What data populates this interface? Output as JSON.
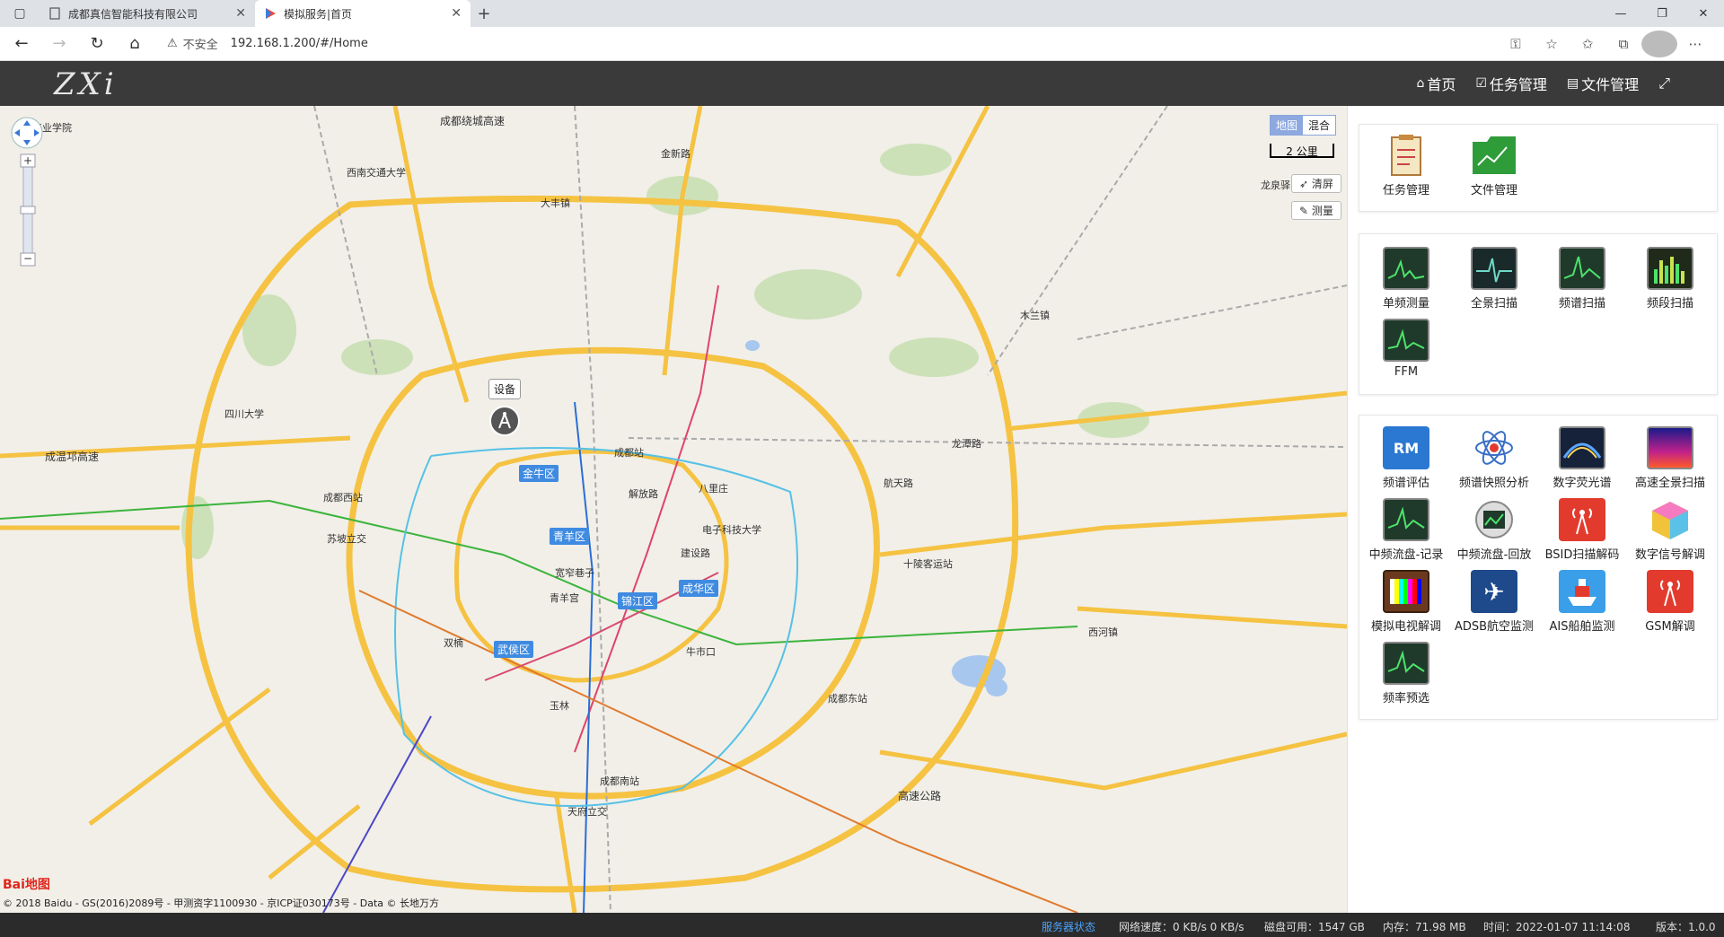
{
  "browser": {
    "tabs": [
      {
        "label": "成都真信智能科技有限公司",
        "active": false
      },
      {
        "label": "模拟服务|首页",
        "active": true
      }
    ],
    "insecure_label": "不安全",
    "url": "192.168.1.200/#/Home"
  },
  "header": {
    "logo": "ZXi",
    "nav": [
      {
        "label": "首页",
        "icon": "home-icon"
      },
      {
        "label": "任务管理",
        "icon": "checkbox-icon"
      },
      {
        "label": "文件管理",
        "icon": "file-icon"
      }
    ]
  },
  "map": {
    "type_options": [
      "地图",
      "混合"
    ],
    "scale": "2 公里",
    "clear_label": "清屏",
    "measure_label": "测量",
    "device_label": "设备",
    "baidu_label": "Bai地图",
    "copyright": "© 2018 Baidu - GS(2016)2089号 - 甲测资字1100930 - 京ICP证030173号 - Data © 长地万方",
    "districts": [
      "金牛区",
      "青羊区",
      "锦江区",
      "成华区",
      "武侯区"
    ],
    "labels": [
      "成都绕城高速",
      "西南交通大学",
      "四川大学",
      "成都站",
      "八里庄",
      "解放路",
      "建设路",
      "成都东站",
      "成都南站",
      "航天路",
      "龙泉驿",
      "双楠",
      "苏坡立交",
      "成温邛高速",
      "龙潭路",
      "西河镇",
      "木兰镇",
      "金新路",
      "大丰镇",
      "天府立交",
      "成都工业学院",
      "牛市口",
      "宽窄巷子",
      "青羊宫",
      "成都西站",
      "电子科技大学",
      "十陵客运站",
      "玉林",
      "高速公路"
    ]
  },
  "panel": {
    "card1": [
      {
        "label": "任务管理",
        "icon": "task-notepad-icon"
      },
      {
        "label": "文件管理",
        "icon": "folder-chart-icon"
      }
    ],
    "card2": [
      {
        "label": "单频测量",
        "icon": "spectrum-monitor-icon"
      },
      {
        "label": "全景扫描",
        "icon": "pulse-monitor-icon"
      },
      {
        "label": "频谱扫描",
        "icon": "spectrum-scan-icon"
      },
      {
        "label": "频段扫描",
        "icon": "band-scan-icon"
      },
      {
        "label": "FFM",
        "icon": "ffm-monitor-icon"
      }
    ],
    "card3": [
      {
        "label": "频谱评估",
        "icon": "rm-evaluate-icon"
      },
      {
        "label": "频谱快照分析",
        "icon": "atom-icon"
      },
      {
        "label": "数字荧光谱",
        "icon": "dpx-icon"
      },
      {
        "label": "高速全景扫描",
        "icon": "heatmap-icon"
      },
      {
        "label": "中频流盘-记录",
        "icon": "if-record-icon"
      },
      {
        "label": "中频流盘-回放",
        "icon": "if-playback-icon"
      },
      {
        "label": "BSID扫描解码",
        "icon": "bsid-tower-icon"
      },
      {
        "label": "数字信号解调",
        "icon": "cube-icon"
      },
      {
        "label": "模拟电视解调",
        "icon": "tv-icon"
      },
      {
        "label": "ADSB航空监测",
        "icon": "airplane-icon"
      },
      {
        "label": "AIS船舶监测",
        "icon": "ship-icon"
      },
      {
        "label": "GSM解调",
        "icon": "gsm-tower-icon"
      },
      {
        "label": "频率预选",
        "icon": "freq-preselect-icon"
      }
    ]
  },
  "status": {
    "service": "服务器状态",
    "network": "网络速度：0 KB/s 0 KB/s",
    "disk": "磁盘可用：1547 GB",
    "memory": "内存：71.98 MB",
    "time": "时间：2022-01-07 11:14:08",
    "version": "版本：1.0.0"
  }
}
